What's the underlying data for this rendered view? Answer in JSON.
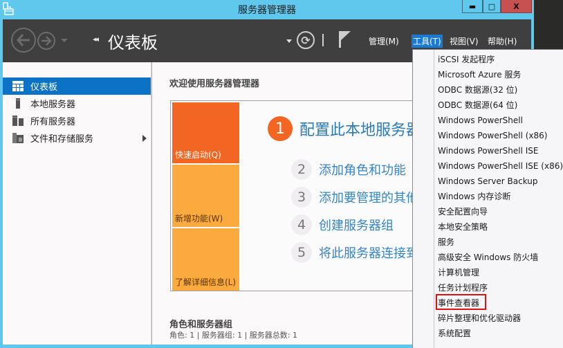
{
  "window": {
    "title": "服务器管理器",
    "controls": {
      "minimize": "▬",
      "maximize": "□",
      "close": "X"
    }
  },
  "header": {
    "breadcrumb_arrows": "◂◂",
    "page_title": "仪表板",
    "refresh_icon": "⟳",
    "menus": [
      {
        "label": "管理(M)"
      },
      {
        "label": "工具(T)",
        "active": true
      },
      {
        "label": "视图(V)"
      },
      {
        "label": "帮助(H)"
      }
    ]
  },
  "sidebar": {
    "items": [
      {
        "label": "仪表板",
        "icon": "dashboard-icon",
        "active": true
      },
      {
        "label": "本地服务器",
        "icon": "local-server-icon"
      },
      {
        "label": "所有服务器",
        "icon": "all-servers-icon"
      },
      {
        "label": "文件和存储服务",
        "icon": "file-storage-icon",
        "expandable": true
      }
    ]
  },
  "main": {
    "welcome_title": "欢迎使用服务器管理器",
    "tiles": [
      {
        "label": "快速启动(Q)"
      },
      {
        "label": "新增功能(W)"
      },
      {
        "label": "了解详细信息(L)"
      }
    ],
    "steps": [
      {
        "num": "1",
        "label": "配置此本地服务器"
      },
      {
        "num": "2",
        "label": "添加角色和功能"
      },
      {
        "num": "3",
        "label": "添加要管理的其他服务器"
      },
      {
        "num": "4",
        "label": "创建服务器组"
      },
      {
        "num": "5",
        "label": "将此服务器连接到云服务"
      }
    ],
    "roles_title": "角色和服务器组",
    "roles_summary": "角色: 1 | 服务器组: 1 | 服务器总数: 1"
  },
  "tools_menu": {
    "items": [
      "iSCSI 发起程序",
      "Microsoft Azure 服务",
      "ODBC 数据源(32 位)",
      "ODBC 数据源(64 位)",
      "Windows PowerShell",
      "Windows PowerShell (x86)",
      "Windows PowerShell ISE",
      "Windows PowerShell ISE (x86)",
      "Windows Server Backup",
      "Windows 内存诊断",
      "安全配置向导",
      "本地安全策略",
      "服务",
      "高级安全 Windows 防火墙",
      "计算机管理",
      "任务计划程序",
      "事件查看器",
      "碎片整理和优化驱动器",
      "系统配置"
    ],
    "highlighted": "事件查看器"
  },
  "colors": {
    "titlebar": "#5fc8ec",
    "header": "#3f3f3f",
    "accent": "#0b72c5",
    "tile_primary": "#f26522",
    "tile_secondary": "#fbaa3e",
    "link": "#3584c4",
    "highlight_box": "#e01010",
    "close_button": "#c75050"
  }
}
